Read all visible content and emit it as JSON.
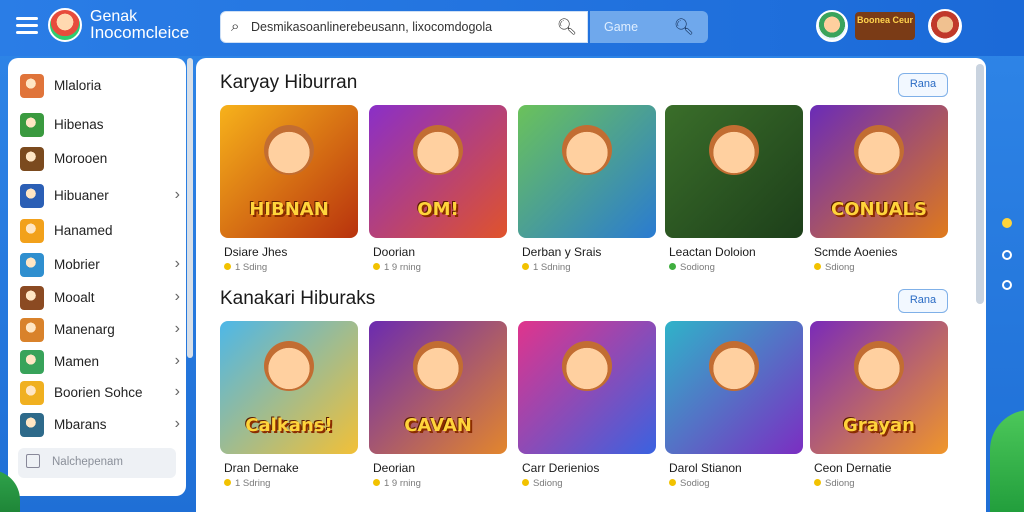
{
  "header": {
    "brand_line1": "Genak",
    "brand_line2": "Inocomcleice",
    "search_value": "Desmikasoanlinerebeusann, lixocomdogola",
    "search2_placeholder": "Game",
    "badge_label": "Boonea Ceur"
  },
  "sidebar": {
    "items": [
      {
        "label": "Mlaloria",
        "chevron": false,
        "icon": "slime-icon",
        "color": "#e0743a"
      },
      {
        "label": "Hibenas",
        "chevron": false,
        "icon": "frog-icon",
        "color": "#3a9a3f"
      },
      {
        "label": "Morooen",
        "chevron": false,
        "icon": "block-icon",
        "color": "#7b4a1e"
      },
      {
        "label": "Hibuaner",
        "chevron": true,
        "icon": "bird-icon",
        "color": "#2b5fb5"
      },
      {
        "label": "Hanamed",
        "chevron": false,
        "icon": "hero-icon",
        "color": "#f2a11b"
      },
      {
        "label": "Mobrier",
        "chevron": true,
        "icon": "puzzle-icon",
        "color": "#2f8fcf"
      },
      {
        "label": "Mooalt",
        "chevron": true,
        "icon": "monkey-icon",
        "color": "#8b4a22"
      },
      {
        "label": "Manenarg",
        "chevron": true,
        "icon": "character-icon",
        "color": "#d9822b"
      },
      {
        "label": "Mamen",
        "chevron": true,
        "icon": "group-icon",
        "color": "#38a35a"
      },
      {
        "label": "Boorien Sohce",
        "chevron": true,
        "icon": "chick-icon",
        "color": "#f0b020"
      },
      {
        "label": "Mbarans",
        "chevron": true,
        "icon": "scene-icon",
        "color": "#2e6a8a"
      }
    ],
    "search_placeholder": "Nalchepenam"
  },
  "sections": [
    {
      "title": "Karyay Hiburran",
      "button": "Rana",
      "cards": [
        {
          "name": "Dsiare Jhes",
          "rating": "1 Sding",
          "art": "HIBNAN",
          "bg": [
            "#f7b21b",
            "#b8320d"
          ],
          "dot": "#f2c200"
        },
        {
          "name": "Doorian",
          "rating": "1 9 rning",
          "art": "OM!",
          "bg": [
            "#8a2fc8",
            "#e0532b"
          ],
          "dot": "#f2c200"
        },
        {
          "name": "Derban y Srais",
          "rating": "1 Sdning",
          "art": "",
          "bg": [
            "#6bc25a",
            "#2a7bd1"
          ],
          "dot": "#f2c200"
        },
        {
          "name": "Leactan Doloion",
          "rating": "Sodiong",
          "art": "",
          "bg": [
            "#3a6e2a",
            "#1d3f1a"
          ],
          "dot": "#3fae3f"
        },
        {
          "name": "Scmde Aoenies",
          "rating": "Sdiong",
          "art": "CONUALS",
          "bg": [
            "#6a2bb8",
            "#e07a1b"
          ],
          "dot": "#f2c200"
        }
      ]
    },
    {
      "title": "Kanakari Hiburaks",
      "button": "Rana",
      "cards": [
        {
          "name": "Dran Dernake",
          "rating": "1 Sdring",
          "art": "Calkans!",
          "bg": [
            "#4db7e8",
            "#f2c037"
          ],
          "dot": "#f2c200"
        },
        {
          "name": "Deorian",
          "rating": "1 9 rning",
          "art": "CAVAN",
          "bg": [
            "#6b2bb0",
            "#e3862c"
          ],
          "dot": "#f2c200"
        },
        {
          "name": "Carr Derienios",
          "rating": "Sdiong",
          "art": "",
          "bg": [
            "#e0348c",
            "#3a62e0"
          ],
          "dot": "#f2c200"
        },
        {
          "name": "Darol Stianon",
          "rating": "Sodiog",
          "art": "",
          "bg": [
            "#2fb3c9",
            "#7b2ec2"
          ],
          "dot": "#f2c200"
        },
        {
          "name": "Ceon Dernatie",
          "rating": "Sdiong",
          "art": "Grayan",
          "bg": [
            "#7a2bb8",
            "#f0962a"
          ],
          "dot": "#f2c200"
        }
      ]
    }
  ]
}
